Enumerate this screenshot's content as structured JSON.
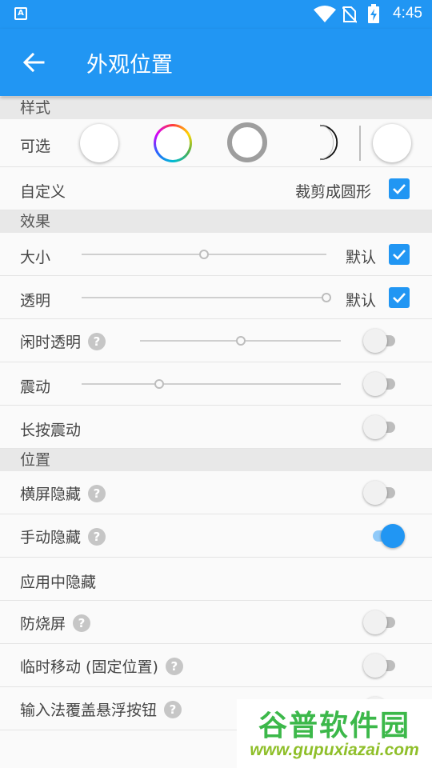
{
  "status_bar": {
    "time": "4:45",
    "app_icon_letter": "A"
  },
  "app_bar": {
    "title": "外观位置"
  },
  "sections": {
    "style": "样式",
    "effect": "效果",
    "position": "位置"
  },
  "style_rows": {
    "optional_label": "可选",
    "custom_label": "自定义",
    "crop_circle_label": "裁剪成圆形",
    "crop_circle_checked": true
  },
  "effect_rows": {
    "size": {
      "label": "大小",
      "default_label": "默认",
      "default_checked": true,
      "level": 0.5
    },
    "transparency": {
      "label": "透明",
      "default_label": "默认",
      "default_checked": true,
      "level": 1.0
    },
    "idle_transparency": {
      "label": "闲时透明",
      "level": 0.5,
      "enabled": false
    },
    "vibration": {
      "label": "震动",
      "level": 0.3,
      "enabled": false
    },
    "long_press_vibration": {
      "label": "长按震动",
      "enabled": false
    }
  },
  "position_rows": {
    "landscape_hide": {
      "label": "横屏隐藏",
      "enabled": false
    },
    "manual_hide": {
      "label": "手动隐藏",
      "enabled": true
    },
    "hide_in_apps": {
      "label": "应用中隐藏"
    },
    "burn_in": {
      "label": "防烧屏",
      "enabled": false
    },
    "temp_move": {
      "label": "临时移动 (固定位置)",
      "enabled": false
    },
    "ime_cover": {
      "label": "输入法覆盖悬浮按钮",
      "enabled": false
    }
  },
  "help_glyph": "?",
  "watermark": {
    "cn": "谷普软件园",
    "url": "www.gupuxiazai.com"
  },
  "colors": {
    "accent": "#2196f3",
    "accent_light": "#90caf9",
    "section_bg": "#e8e8e8"
  }
}
